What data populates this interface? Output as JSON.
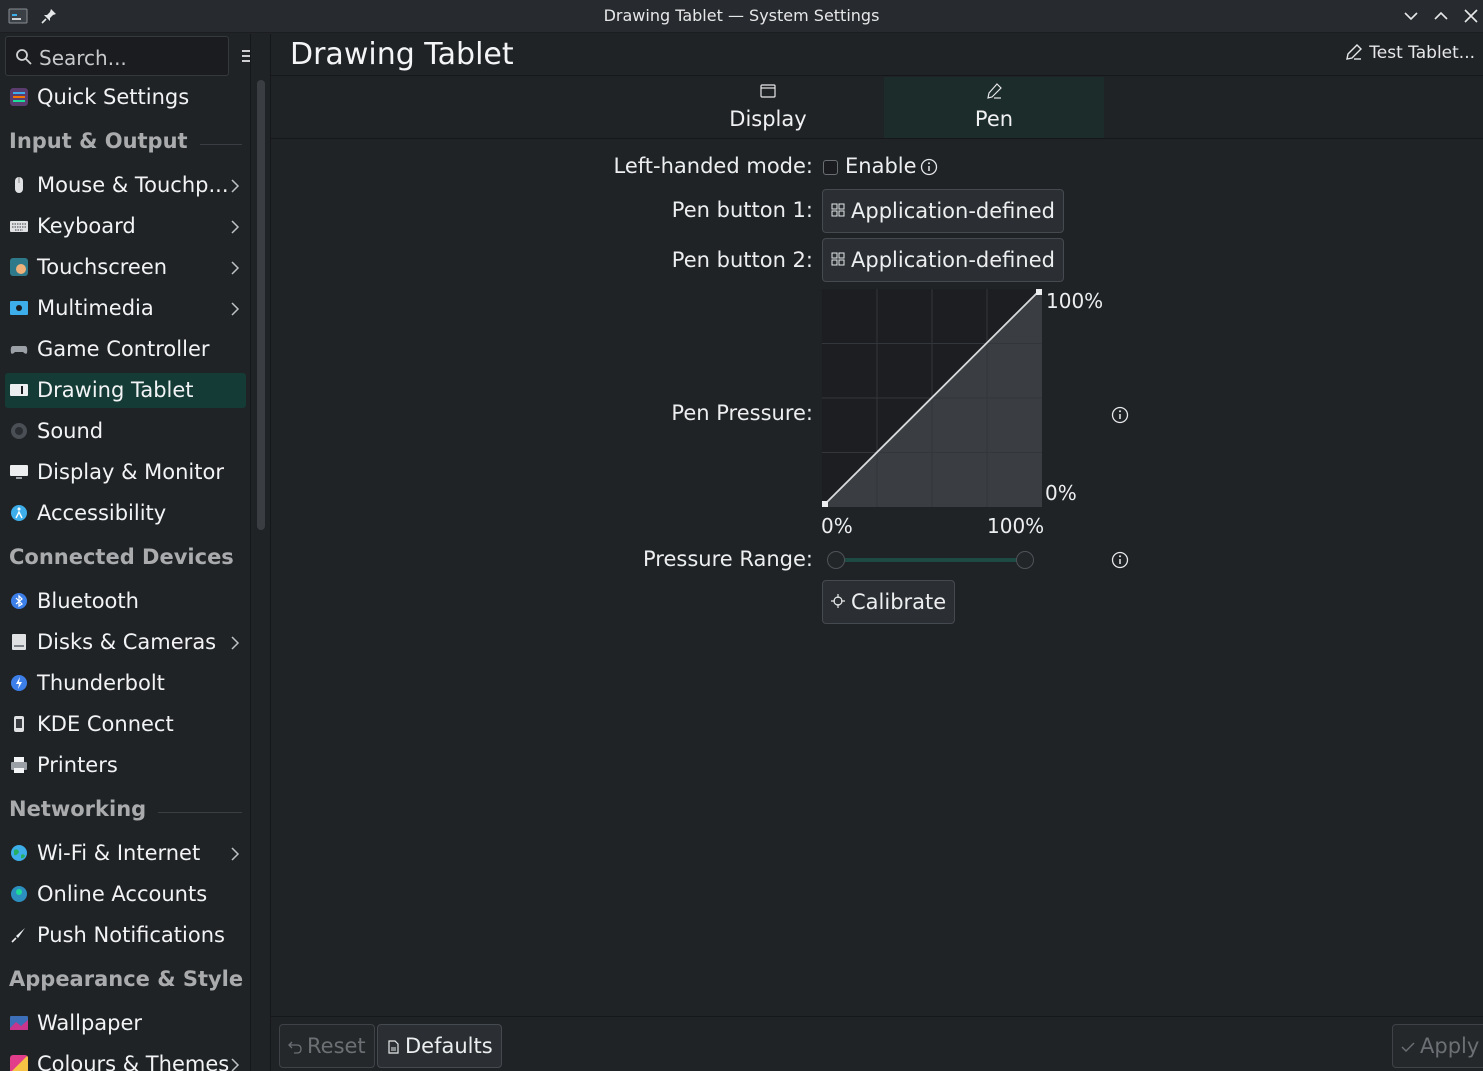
{
  "window": {
    "title": "Drawing Tablet — System Settings"
  },
  "sidebar": {
    "search_placeholder": "Search...",
    "quick_settings": "Quick Settings",
    "sections": [
      {
        "title": "Input & Output",
        "items": [
          {
            "label": "Mouse & Touchp...",
            "icon": "mouse-icon",
            "has_children": true
          },
          {
            "label": "Keyboard",
            "icon": "keyboard-icon",
            "has_children": true
          },
          {
            "label": "Touchscreen",
            "icon": "touchscreen-icon",
            "has_children": true
          },
          {
            "label": "Multimedia",
            "icon": "multimedia-icon",
            "has_children": true
          },
          {
            "label": "Game Controller",
            "icon": "gamepad-icon",
            "has_children": false
          },
          {
            "label": "Drawing Tablet",
            "icon": "tablet-icon",
            "has_children": false,
            "active": true
          },
          {
            "label": "Sound",
            "icon": "speaker-icon",
            "has_children": false
          },
          {
            "label": "Display & Monitor",
            "icon": "monitor-icon",
            "has_children": false
          },
          {
            "label": "Accessibility",
            "icon": "accessibility-icon",
            "has_children": false
          }
        ]
      },
      {
        "title": "Connected Devices",
        "items": [
          {
            "label": "Bluetooth",
            "icon": "bluetooth-icon",
            "has_children": false
          },
          {
            "label": "Disks & Cameras",
            "icon": "disk-icon",
            "has_children": true
          },
          {
            "label": "Thunderbolt",
            "icon": "thunderbolt-icon",
            "has_children": false
          },
          {
            "label": "KDE Connect",
            "icon": "phone-icon",
            "has_children": false
          },
          {
            "label": "Printers",
            "icon": "printer-icon",
            "has_children": false
          }
        ]
      },
      {
        "title": "Networking",
        "items": [
          {
            "label": "Wi-Fi & Internet",
            "icon": "globe-icon",
            "has_children": true
          },
          {
            "label": "Online Accounts",
            "icon": "accounts-icon",
            "has_children": false
          },
          {
            "label": "Push Notifications",
            "icon": "push-icon",
            "has_children": false
          }
        ]
      },
      {
        "title": "Appearance & Style",
        "items": [
          {
            "label": "Wallpaper",
            "icon": "wallpaper-icon",
            "has_children": false
          },
          {
            "label": "Colours & Themes",
            "icon": "themes-icon",
            "has_children": true
          }
        ]
      }
    ]
  },
  "header": {
    "title": "Drawing Tablet",
    "test_button": "Test Tablet..."
  },
  "tabs": [
    {
      "label": "Display",
      "icon": "display-tab-icon",
      "active": false
    },
    {
      "label": "Pen",
      "icon": "pen-tab-icon",
      "active": true
    }
  ],
  "form": {
    "left_handed_label": "Left-handed mode:",
    "enable_label": "Enable",
    "enable_checked": false,
    "pen_button_1_label": "Pen button 1:",
    "pen_button_1_value": "Application-defined",
    "pen_button_2_label": "Pen button 2:",
    "pen_button_2_value": "Application-defined",
    "pen_pressure_label": "Pen Pressure:",
    "curve_y_max": "100%",
    "curve_y_min": "0%",
    "curve_x_min": "0%",
    "curve_x_max": "100%",
    "pressure_range_label": "Pressure Range:",
    "pressure_range_min": 0,
    "pressure_range_max": 1,
    "calibrate_label": "Calibrate"
  },
  "footer": {
    "reset_label": "Reset",
    "defaults_label": "Defaults",
    "apply_label": "Apply"
  },
  "colors": {
    "accent": "#153b36",
    "background": "#202326",
    "text": "#fcfcfc"
  }
}
